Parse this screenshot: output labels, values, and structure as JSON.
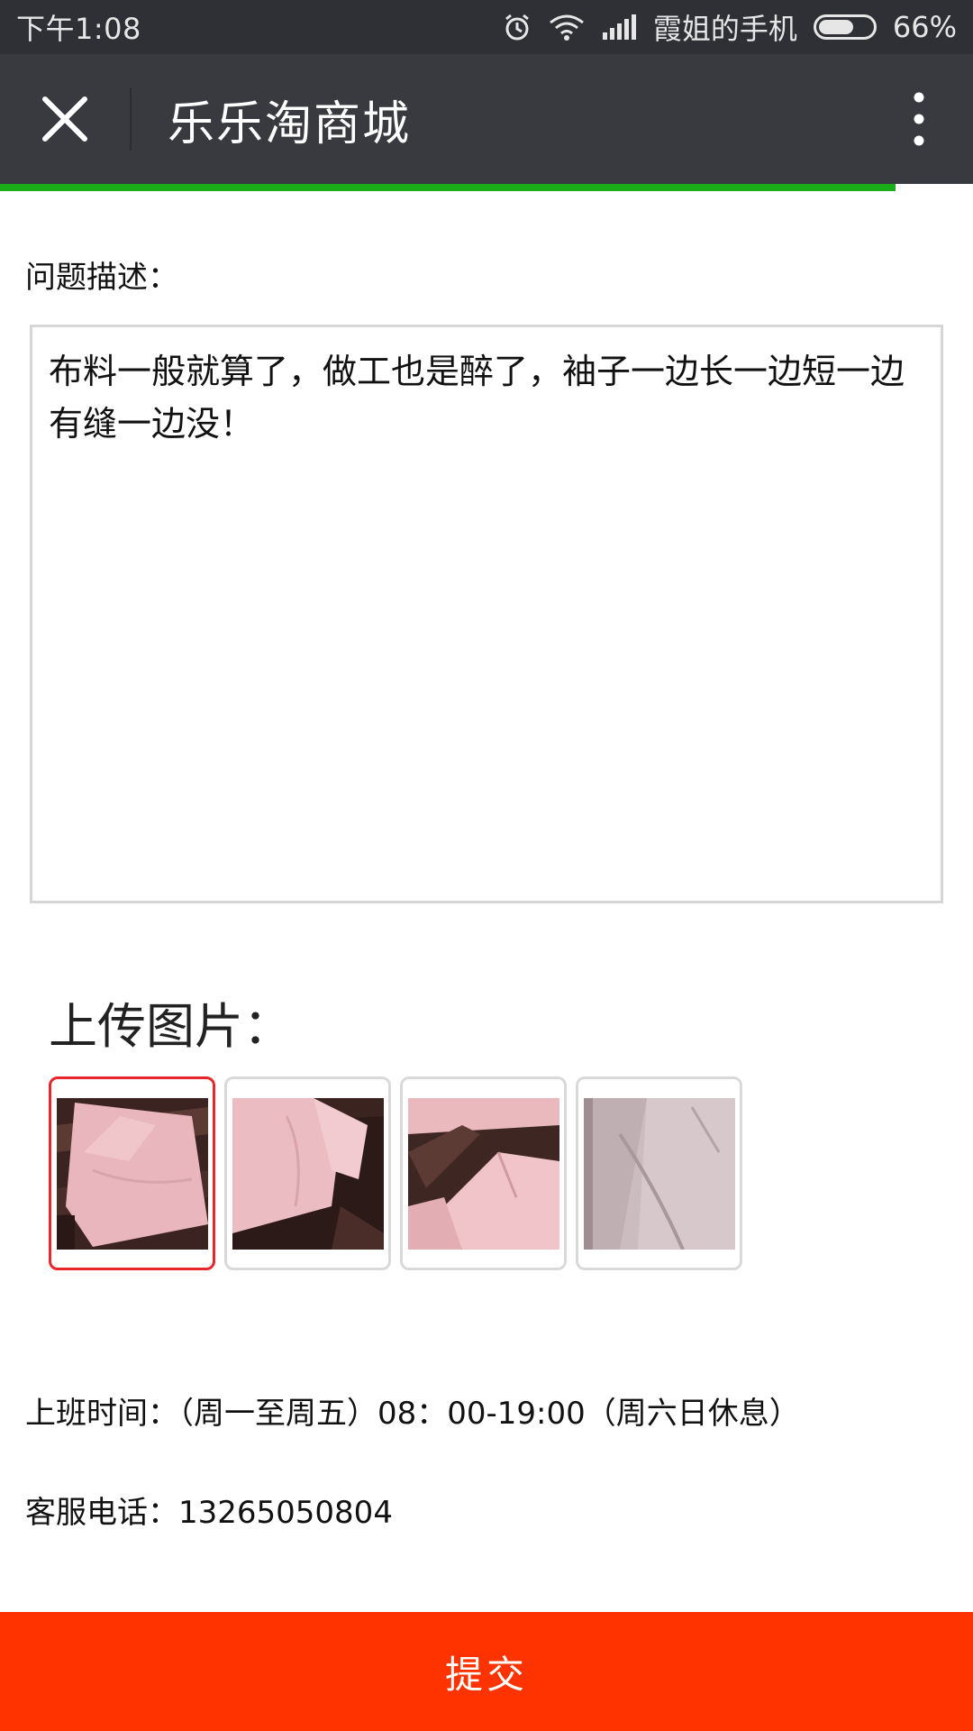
{
  "status_bar": {
    "time": "下午1:08",
    "carrier": "霞姐的手机",
    "battery": "66%",
    "battery_level": 0.66,
    "icons": [
      "alarm-icon",
      "wifi-icon",
      "signal-icon",
      "battery-icon"
    ]
  },
  "header": {
    "title": "乐乐淘商城",
    "close_icon": "close-icon",
    "more_icon": "more-vertical-icon",
    "progress": 0.92
  },
  "form": {
    "description_label": "问题描述：",
    "description_value": "布料一般就算了，做工也是醉了，袖子一边长一边短一边有缝一边没！",
    "upload_label": "上传图片：",
    "images": [
      {
        "name": "photo-1",
        "selected": true
      },
      {
        "name": "photo-2",
        "selected": false
      },
      {
        "name": "photo-3",
        "selected": false
      },
      {
        "name": "photo-4",
        "selected": false
      }
    ]
  },
  "info": {
    "work_hours": "上班时间：（周一至周五）08：00-19:00（周六日休息）",
    "phone": "客服电话：13265050804"
  },
  "submit_label": "提交",
  "colors": {
    "status_bar_bg": "#2f3035",
    "header_bg": "#393a3f",
    "progress": "#1aad19",
    "submit_bg": "#ff3300",
    "selected_border": "#e8262b"
  }
}
